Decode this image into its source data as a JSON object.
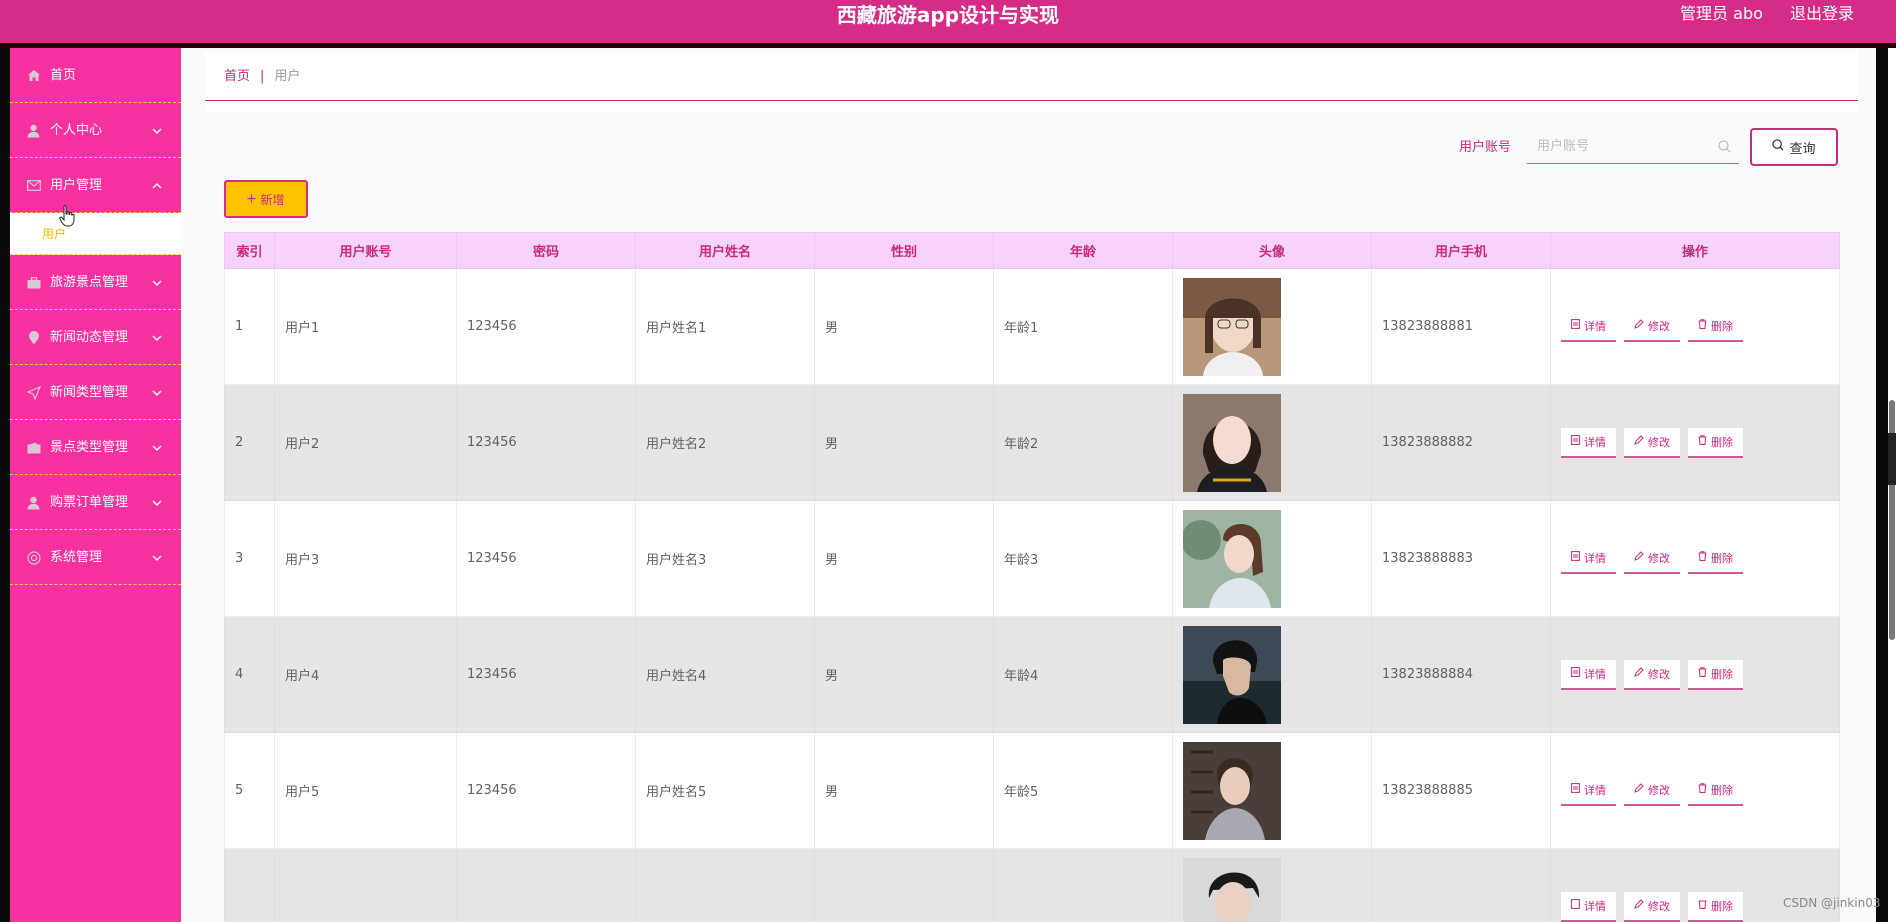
{
  "header": {
    "title": "西藏旅游app设计与实现",
    "admin_label": "管理员 abo",
    "logout_label": "退出登录"
  },
  "sidebar": {
    "items": [
      {
        "label": "首页",
        "icon": "home-icon"
      },
      {
        "label": "个人中心",
        "icon": "user-icon"
      },
      {
        "label": "用户管理",
        "icon": "mail-icon"
      },
      {
        "label": "旅游景点管理",
        "icon": "briefcase-icon"
      },
      {
        "label": "新闻动态管理",
        "icon": "location-icon"
      },
      {
        "label": "新闻类型管理",
        "icon": "send-icon"
      },
      {
        "label": "景点类型管理",
        "icon": "wallet-icon"
      },
      {
        "label": "购票订单管理",
        "icon": "user-icon"
      },
      {
        "label": "系统管理",
        "icon": "settings-icon"
      }
    ],
    "submenu_label": "用户"
  },
  "breadcrumb": {
    "home": "首页",
    "separator": "|",
    "current": "用户"
  },
  "search": {
    "label": "用户账号",
    "placeholder": "用户账号",
    "button_label": "查询"
  },
  "toolbar": {
    "add_label": "新增"
  },
  "table": {
    "columns": [
      "索引",
      "用户账号",
      "密码",
      "用户姓名",
      "性别",
      "年龄",
      "头像",
      "用户手机",
      "操作"
    ],
    "actions": [
      "详情",
      "修改",
      "删除"
    ],
    "rows": [
      {
        "index": "1",
        "account": "用户1",
        "password": "123456",
        "name": "用户姓名1",
        "gender": "男",
        "age": "年龄1",
        "phone": "13823888881"
      },
      {
        "index": "2",
        "account": "用户2",
        "password": "123456",
        "name": "用户姓名2",
        "gender": "男",
        "age": "年龄2",
        "phone": "13823888882"
      },
      {
        "index": "3",
        "account": "用户3",
        "password": "123456",
        "name": "用户姓名3",
        "gender": "男",
        "age": "年龄3",
        "phone": "13823888883"
      },
      {
        "index": "4",
        "account": "用户4",
        "password": "123456",
        "name": "用户姓名4",
        "gender": "男",
        "age": "年龄4",
        "phone": "13823888884"
      },
      {
        "index": "5",
        "account": "用户5",
        "password": "123456",
        "name": "用户姓名5",
        "gender": "男",
        "age": "年龄5",
        "phone": "13823888885"
      },
      {
        "index": "",
        "account": "",
        "password": "",
        "name": "",
        "gender": "",
        "age": "",
        "phone": ""
      }
    ]
  },
  "colors": {
    "header": "#d52d87",
    "sidebar": "#f7319f",
    "accent": "#c92a7a",
    "add_button": "#ffc200",
    "table_header": "#f7d3fb"
  },
  "watermark": "CSDN @jinkin03"
}
